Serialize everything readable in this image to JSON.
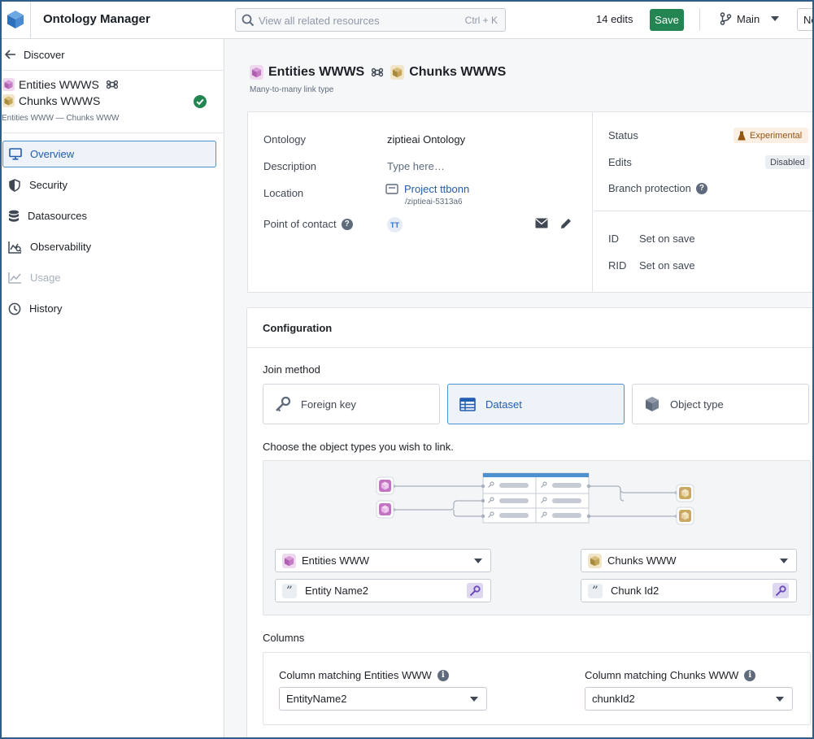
{
  "header": {
    "app_title": "Ontology Manager",
    "search_placeholder": "View all related resources",
    "search_shortcut": "Ctrl + K",
    "edits_count": "14 edits",
    "save_label": "Save",
    "branch_label": "Main",
    "new_label": "Ne"
  },
  "sidebar": {
    "back_label": "Discover",
    "object_line1": "Entities WWWS",
    "object_line2": "Chunks WWWS",
    "object_subtitle": "Entities WWW — Chunks WWW",
    "items": [
      {
        "label": "Overview",
        "icon": "monitor-icon",
        "active": true
      },
      {
        "label": "Security",
        "icon": "shield-icon"
      },
      {
        "label": "Datasources",
        "icon": "database-icon"
      },
      {
        "label": "Observability",
        "icon": "observability-icon"
      },
      {
        "label": "Usage",
        "icon": "chart-line-icon",
        "disabled": true
      },
      {
        "label": "History",
        "icon": "history-icon"
      }
    ]
  },
  "main": {
    "title_left": "Entities WWWS",
    "title_right": "Chunks WWWS",
    "subtitle": "Many-to-many link type",
    "properties": {
      "ontology_label": "Ontology",
      "ontology_value": "ziptieai Ontology",
      "description_label": "Description",
      "description_placeholder": "Type here…",
      "location_label": "Location",
      "location_value": "Project ttbonn",
      "location_path": "/ziptieai-5313a6",
      "contact_label": "Point of contact",
      "contact_initials": "TT"
    },
    "status": {
      "status_label": "Status",
      "status_value": "Experimental",
      "edits_label": "Edits",
      "edits_value": "Disabled",
      "branch_protection_label": "Branch protection",
      "id_label": "ID",
      "id_value": "Set on save",
      "rid_label": "RID",
      "rid_value": "Set on save"
    },
    "configuration": {
      "title": "Configuration",
      "join_method_label": "Join method",
      "join_options": [
        "Foreign key",
        "Dataset",
        "Object type"
      ],
      "selected_join": "Dataset",
      "choose_label": "Choose the object types you wish to link.",
      "left_object": "Entities WWW",
      "right_object": "Chunks WWW",
      "left_key": "Entity Name2",
      "right_key": "Chunk Id2",
      "columns_label": "Columns",
      "left_column_label": "Column matching Entities WWW",
      "right_column_label": "Column matching Chunks WWW",
      "left_column_value": "EntityName2",
      "right_column_value": "chunkId2"
    }
  },
  "colors": {
    "accent": "#215db0",
    "save_green": "#238551",
    "entity_purple": "#c274c2",
    "chunk_gold": "#c9a860"
  }
}
